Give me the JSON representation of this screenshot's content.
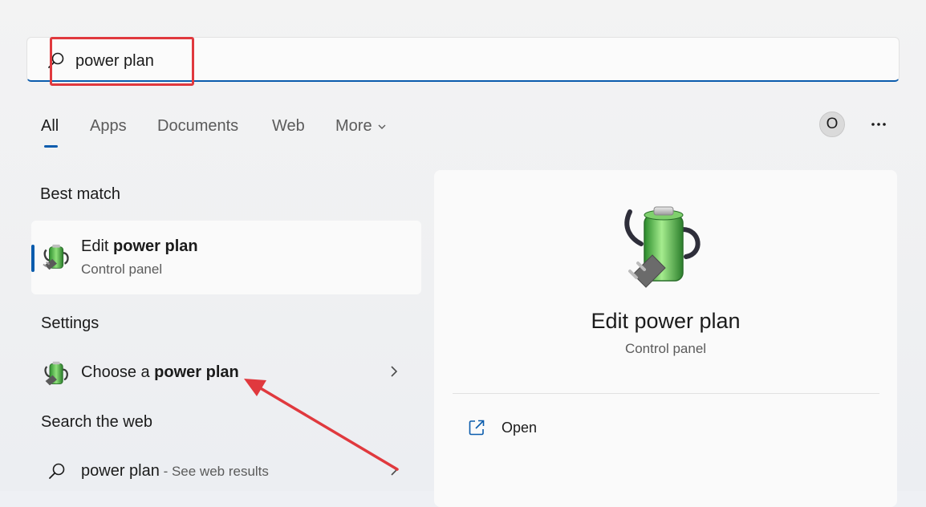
{
  "search": {
    "value": "power plan"
  },
  "tabs": [
    {
      "label": "All"
    },
    {
      "label": "Apps"
    },
    {
      "label": "Documents"
    },
    {
      "label": "Web"
    },
    {
      "label": "More"
    }
  ],
  "account": {
    "initial": "O"
  },
  "sections": {
    "best_match": "Best match",
    "settings": "Settings",
    "search_web": "Search the web"
  },
  "best_match": {
    "title_prefix": "Edit ",
    "title_bold": "power plan",
    "subtitle": "Control panel",
    "icon": "power-plan-icon"
  },
  "settings_item": {
    "prefix": "Choose a ",
    "bold": "power plan",
    "icon": "power-plan-icon"
  },
  "web_item": {
    "query": "power plan",
    "suffix": " - See web results",
    "icon": "search-icon"
  },
  "detail": {
    "title": "Edit power plan",
    "subtitle": "Control panel",
    "actions": [
      {
        "label": "Open",
        "icon": "open-external-icon"
      }
    ]
  },
  "colors": {
    "accent": "#0b5cad",
    "annotation": "#e0393e"
  }
}
